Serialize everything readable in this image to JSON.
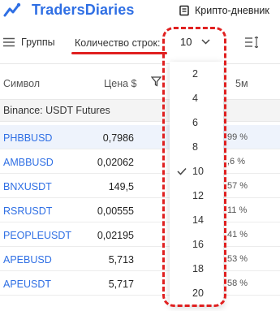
{
  "header": {
    "brand": "TradersDiaries",
    "journal_label": "Крипто-дневник"
  },
  "toolbar": {
    "groups_label": "Группы",
    "rows_label": "Количество строк:",
    "rows_value": "10"
  },
  "table": {
    "columns": [
      "Символ",
      "Цена $",
      "5м"
    ],
    "group_label": "Binance: USDT Futures",
    "rows": [
      {
        "symbol": "PHBBUSD",
        "price": "0,7986",
        "change": "99 %"
      },
      {
        "symbol": "AMBBUSD",
        "price": "0,02062",
        "change": ",6 %"
      },
      {
        "symbol": "BNXUSDT",
        "price": "149,5",
        "change": "57 %"
      },
      {
        "symbol": "RSRUSDT",
        "price": "0,00555",
        "change": "11 %"
      },
      {
        "symbol": "PEOPLEUSDT",
        "price": "0,02195",
        "change": "41 %"
      },
      {
        "symbol": "APEBUSD",
        "price": "5,713",
        "change": "53 %"
      },
      {
        "symbol": "APEUSDT",
        "price": "5,717",
        "change": "58 %"
      }
    ]
  },
  "dropdown": {
    "options": [
      "2",
      "4",
      "6",
      "8",
      "10",
      "12",
      "14",
      "16",
      "18",
      "20"
    ],
    "selected": "10"
  },
  "colors": {
    "brand": "#2f6fe4",
    "annotation": "#e02020",
    "active_row": "#eef3fc"
  }
}
